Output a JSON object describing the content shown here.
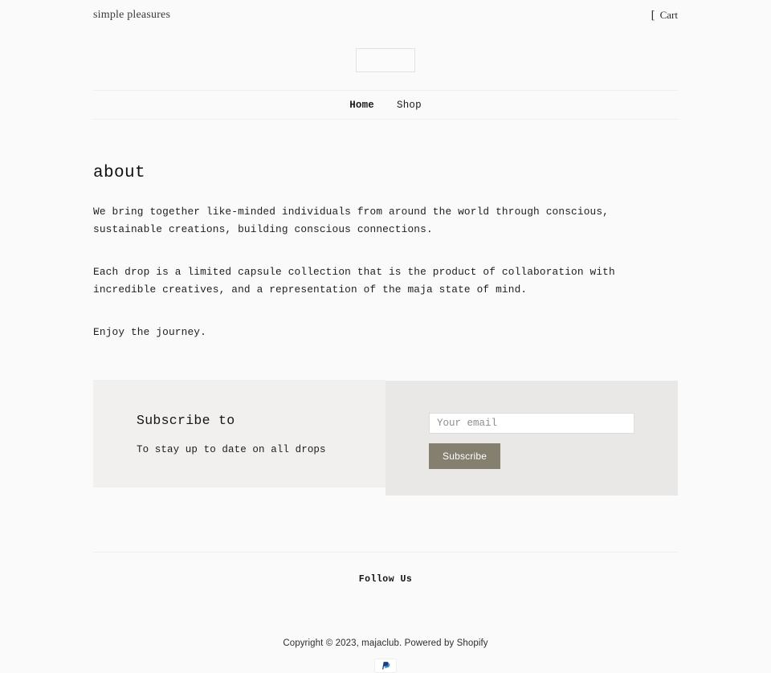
{
  "header": {
    "tagline": "simple pleasures",
    "cart_glyph": "[",
    "cart_label": "Cart",
    "logo_alt": ""
  },
  "nav": {
    "items": [
      {
        "label": "Home",
        "active": true
      },
      {
        "label": "Shop",
        "active": false
      }
    ]
  },
  "main": {
    "title": "about",
    "paragraphs": [
      "We bring together like-minded individuals from around the world through conscious, sustainable creations, building conscious connections.",
      "Each drop is a limited capsule collection that is the product of collaboration with incredible creatives, and a representation of the maja state of mind.",
      "Enjoy the journey."
    ]
  },
  "newsletter": {
    "title": "Subscribe to",
    "subtitle": "To stay up to date on all drops",
    "email_placeholder": "Your email",
    "email_value": "",
    "button_label": "Subscribe",
    "button_color": "#847f6f",
    "panel_left_color": "#f1f0ef",
    "panel_right_color": "#e9e8e6"
  },
  "footer": {
    "follow_us": "Follow Us",
    "copyright": "Copyright © 2023, majaclub. Powered by Shopify",
    "payment_icons": [
      {
        "name": "paypal-icon",
        "label": "PayPal"
      }
    ]
  },
  "theme": {
    "background": "#fafafa",
    "text": "#1c1c1c",
    "rule": "#efefef"
  }
}
